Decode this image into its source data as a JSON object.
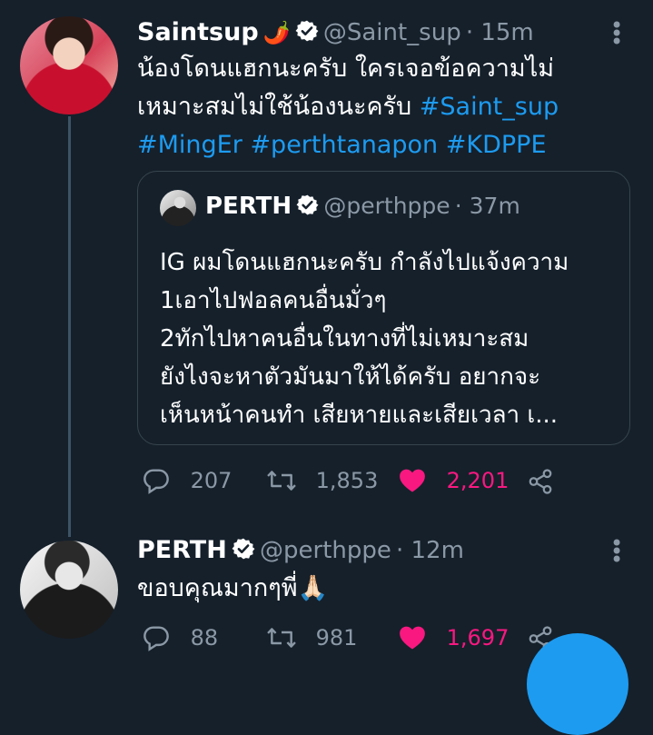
{
  "tweet1": {
    "name": "Saintsup",
    "emoji": "🌶️",
    "handle": "@Saint_sup",
    "time": "· 15m",
    "text_line1": "น้องโดนแฮกนะครับ ใครเจอข้อความไม่",
    "text_line2": "เหมาะสมไม่ใช้น้องนะครับ",
    "hashtags": [
      "#Saint_sup",
      "#MingEr",
      "#perthtanapon",
      "#KDPPE"
    ],
    "quote": {
      "name": "PERTH",
      "handle": "@perthppe",
      "time": "· 37m",
      "lines": [
        "IG ผมโดนแฮกนะครับ กำลังไปแจ้งความ",
        "1เอาไปฟอลคนอื่นมั่วๆ",
        "2ทักไปหาคนอื่นในทางที่ไม่เหมาะสม",
        "ยังไงจะหาตัวมันมาให้ได้ครับ อยากจะ",
        "เห็นหน้าคนทำ เสียหายและเสียเวลา เ..."
      ]
    },
    "replies": "207",
    "retweets": "1,853",
    "likes": "2,201"
  },
  "tweet2": {
    "name": "PERTH",
    "handle": "@perthppe",
    "time": "· 12m",
    "text": "ขอบคุณมากๆพี่🙏🏻",
    "replies": "88",
    "retweets": "981",
    "likes": "1,697"
  },
  "colors": {
    "background": "#15202b",
    "accent": "#1d9bf0",
    "like": "#f91880",
    "muted": "#8b98a5"
  }
}
